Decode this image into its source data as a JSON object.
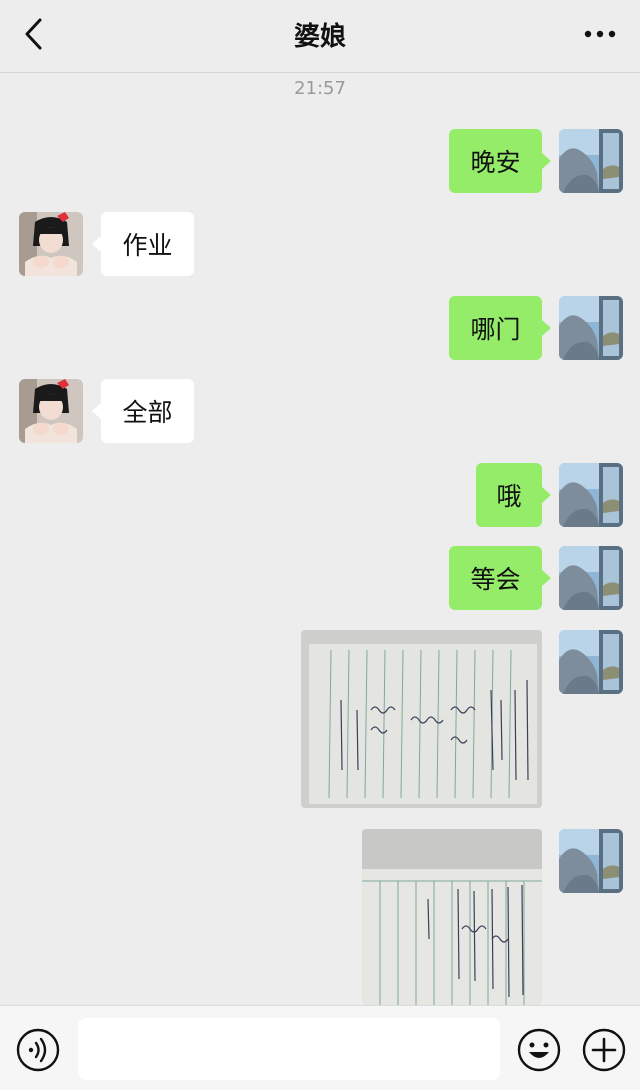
{
  "header": {
    "title": "婆娘"
  },
  "chat": {
    "timestamp": "21:57",
    "messages": [
      {
        "from": "me",
        "text": "晚安"
      },
      {
        "from": "them",
        "text": "作业"
      },
      {
        "from": "me",
        "text": "哪门"
      },
      {
        "from": "them",
        "text": "全部"
      },
      {
        "from": "me",
        "text": "哦"
      },
      {
        "from": "me",
        "text": "等会"
      },
      {
        "from": "me",
        "type": "image"
      },
      {
        "from": "me",
        "type": "image"
      }
    ]
  },
  "input": {
    "value": "",
    "placeholder": ""
  },
  "icons": {
    "back": "chevron-left-icon",
    "more": "more-dots-icon",
    "voice": "voice-icon",
    "emoji": "emoji-icon",
    "plus": "plus-icon"
  },
  "colors": {
    "my_bubble": "#95ec69",
    "their_bubble": "#ffffff",
    "background": "#ededed"
  }
}
